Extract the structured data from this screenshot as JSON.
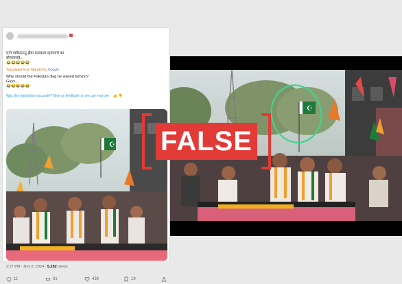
{
  "tweet": {
    "lines": [
      "मगो पाकिस्तानु झेंडा फडकला म्हणायचे का",
      "बोपल्याचो...",
      "😂😂😂😂😂"
    ],
    "translated_prefix": "Translated from Marathi by",
    "translated_brand": "Google",
    "translation_lines": [
      "Why should the Pakistani flag be waved behind?",
      "Guys....",
      "😂😂😂😂😂"
    ],
    "feedback": "Was this translation accurate? Give us feedback so we can improve:",
    "feedback_icons": "👍 👎",
    "time": "2:27 PM · Nov 8, 2024 ·",
    "views_count": "5,252",
    "views_label": "Views",
    "stats": {
      "replies": "11",
      "reposts": "81",
      "likes": "436",
      "bookmarks": "19"
    }
  },
  "verdict": "FALSE",
  "colors": {
    "stamp_red": "#e23a36",
    "highlight_circle": "#3fd48c",
    "flag_green": "#1e7a3a",
    "saffron": "#f0a030"
  },
  "icons": [
    "reply-icon",
    "repost-icon",
    "like-icon",
    "bookmark-icon",
    "share-icon"
  ]
}
